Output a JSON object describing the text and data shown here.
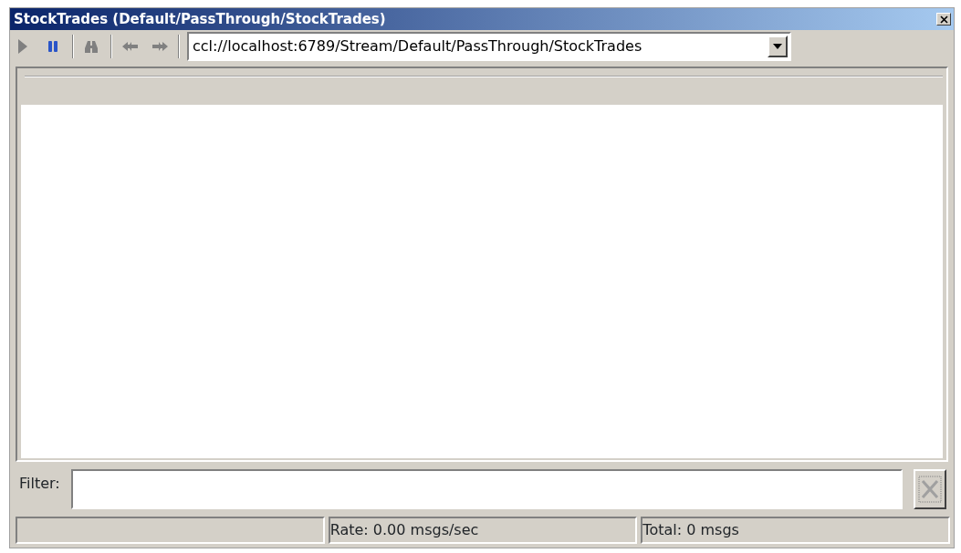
{
  "window": {
    "title": "StockTrades (Default/PassThrough/StockTrades)"
  },
  "toolbar": {
    "buttons": [
      {
        "kind": "play",
        "disabled": true
      },
      {
        "kind": "pause",
        "disabled": false
      },
      {
        "kind": "separator"
      },
      {
        "kind": "find",
        "disabled": true
      },
      {
        "kind": "separator"
      },
      {
        "kind": "back",
        "disabled": true
      },
      {
        "kind": "forward",
        "disabled": true
      },
      {
        "kind": "separator"
      }
    ],
    "address": {
      "value": "ccl://localhost:6789/Stream/Default/PassThrough/StockTrades"
    }
  },
  "filter": {
    "label": "Filter:",
    "clear_disabled": true
  },
  "status_bar": {
    "rate": "Rate: 0.00 msgs/sec",
    "total": "Total: 0 msgs"
  }
}
